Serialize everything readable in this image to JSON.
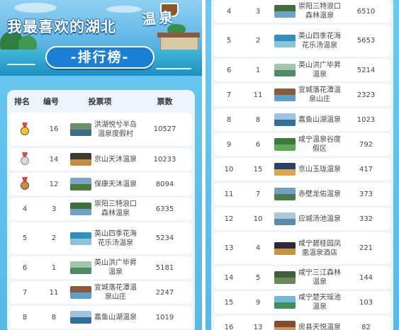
{
  "banner": {
    "title": "我最喜欢的湖北",
    "title_hot": "温泉",
    "subtitle": "-排行榜-"
  },
  "table": {
    "headers": {
      "rank": "排名",
      "id": "编号",
      "item": "投票项",
      "votes": "票数"
    }
  },
  "left_rows": [
    {
      "rank": "",
      "medal": "gold",
      "id": "16",
      "name": "洪湖悦兮半岛温泉度假村",
      "votes": "10527",
      "thumb": [
        "#6a8f6a",
        "#3d6b8a"
      ]
    },
    {
      "rank": "",
      "medal": "silver",
      "id": "14",
      "name": "京山天沐温泉",
      "votes": "10233",
      "thumb": [
        "#3b3a34",
        "#c48a3e"
      ]
    },
    {
      "rank": "",
      "medal": "bronze",
      "id": "12",
      "name": "保康天沐温泉",
      "votes": "8094",
      "thumb": [
        "#7aa6c9",
        "#4b7a3a"
      ]
    },
    {
      "rank": "4",
      "medal": "",
      "id": "3",
      "name": "崇阳三特浪口森林温泉",
      "votes": "6335",
      "thumb": [
        "#3f6f3a",
        "#6ca3c6"
      ]
    },
    {
      "rank": "5",
      "medal": "",
      "id": "2",
      "name": "英山四季花海花乐汤温泉",
      "votes": "5234",
      "thumb": [
        "#2f8fbf",
        "#8ac4d9"
      ]
    },
    {
      "rank": "6",
      "medal": "",
      "id": "1",
      "name": "英山洪广毕昇温泉",
      "votes": "5181",
      "thumb": [
        "#9fc7a8",
        "#4f8a6a"
      ]
    },
    {
      "rank": "7",
      "medal": "",
      "id": "11",
      "name": "宜城落花潭温泉山庄",
      "votes": "2247",
      "thumb": [
        "#8b5a3a",
        "#5aa0c8"
      ]
    },
    {
      "rank": "8",
      "medal": "",
      "id": "8",
      "name": "嘉鱼山湖温泉",
      "votes": "1019",
      "thumb": [
        "#9cc3e0",
        "#2f6f9a"
      ]
    }
  ],
  "right_rows": [
    {
      "rank": "4",
      "id": "3",
      "name": "崇阳三特浪口森林温泉",
      "votes": "6510",
      "thumb": [
        "#3f6f3a",
        "#6ca3c6"
      ]
    },
    {
      "rank": "5",
      "id": "2",
      "name": "英山四季花海花乐汤温泉",
      "votes": "5653",
      "thumb": [
        "#2f8fbf",
        "#8ac4d9"
      ]
    },
    {
      "rank": "6",
      "id": "1",
      "name": "英山洪广毕昇温泉",
      "votes": "5214",
      "thumb": [
        "#9fc7a8",
        "#4f8a6a"
      ]
    },
    {
      "rank": "7",
      "id": "11",
      "name": "宜城落花潭温泉山庄",
      "votes": "2323",
      "thumb": [
        "#8b5a3a",
        "#5aa0c8"
      ]
    },
    {
      "rank": "8",
      "id": "8",
      "name": "嘉鱼山湖温泉",
      "votes": "1023",
      "thumb": [
        "#9cc3e0",
        "#2f6f9a"
      ]
    },
    {
      "rank": "9",
      "id": "6",
      "name": "咸宁温泉谷度假区",
      "votes": "792",
      "thumb": [
        "#3a7a3a",
        "#5fa85a"
      ]
    },
    {
      "rank": "10",
      "id": "15",
      "name": "京山玉珑温泉",
      "votes": "417",
      "thumb": [
        "#2a3f6a",
        "#d9a84a"
      ]
    },
    {
      "rank": "11",
      "id": "7",
      "name": "赤壁龙佑温泉",
      "votes": "373",
      "thumb": [
        "#6f9fc8",
        "#4d7a4a"
      ]
    },
    {
      "rank": "12",
      "id": "10",
      "name": "应城汤池温泉",
      "votes": "332",
      "thumb": [
        "#a8c8e0",
        "#5a8aa8"
      ]
    },
    {
      "rank": "13",
      "id": "4",
      "name": "咸宁碧桂园凤凰温泉酒店",
      "votes": "221",
      "thumb": [
        "#2a2a3a",
        "#c8923a"
      ]
    },
    {
      "rank": "14",
      "id": "5",
      "name": "咸宁三江森林温泉",
      "votes": "144",
      "thumb": [
        "#3f5f3a",
        "#6a8a5a"
      ]
    },
    {
      "rank": "15",
      "id": "9",
      "name": "咸宁楚天瑶池温泉",
      "votes": "103",
      "thumb": [
        "#6fb8d8",
        "#3f8f5a"
      ]
    },
    {
      "rank": "16",
      "id": "13",
      "name": "房县天悦温泉",
      "votes": "82",
      "thumb": [
        "#8a4a2a",
        "#c89a6a"
      ]
    }
  ]
}
